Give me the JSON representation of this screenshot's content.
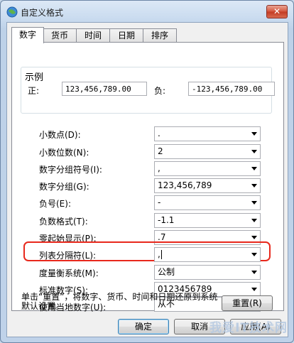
{
  "window": {
    "title": "自定义格式",
    "close_glyph": "✕"
  },
  "tabs": [
    "数字",
    "货币",
    "时间",
    "日期",
    "排序"
  ],
  "sample": {
    "title": "示例",
    "positive_label": "正:",
    "positive_value": "123,456,789.00",
    "negative_label": "负:",
    "negative_value": "-123,456,789.00"
  },
  "settings": [
    {
      "label": "小数点(D):",
      "value": "."
    },
    {
      "label": "小数位数(N):",
      "value": "2"
    },
    {
      "label": "数字分组符号(I):",
      "value": ","
    },
    {
      "label": "数字分组(G):",
      "value": "123,456,789"
    },
    {
      "label": "负号(E):",
      "value": "-"
    },
    {
      "label": "负数格式(T):",
      "value": "-1.1"
    },
    {
      "label": "零起始显示(P):",
      "value": ".7"
    },
    {
      "label": "列表分隔符(L):",
      "value": ","
    },
    {
      "label": "度量衡系统(M):",
      "value": "公制"
    },
    {
      "label": "标准数字(S):",
      "value": "0123456789"
    },
    {
      "label": "使用当地数字(U):",
      "value": "从不"
    }
  ],
  "note": "单击“重置”，将数字、货币、时间和日期还原到系统默认设置。",
  "buttons": {
    "reset": "重置(R)",
    "ok": "确定",
    "cancel": "取消",
    "apply": "应用(A)"
  },
  "watermark": "我爱IT技术网",
  "icons": {
    "app": "globe-icon",
    "close": "close-icon",
    "dropdown": "chevron-down-icon"
  }
}
